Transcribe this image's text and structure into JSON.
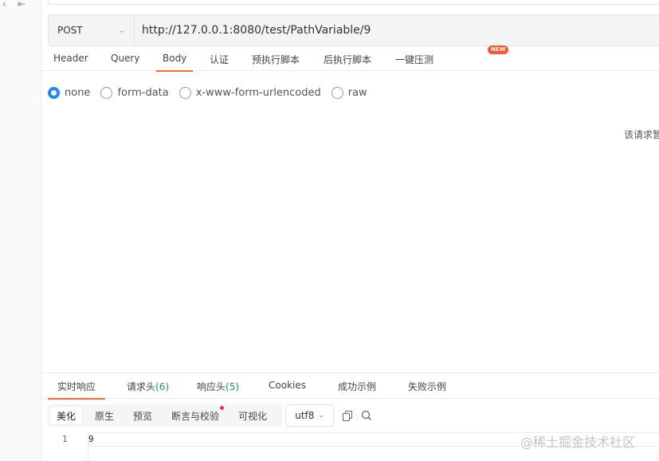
{
  "sidebar": {
    "glyphs": [
      "‹",
      "⇤"
    ]
  },
  "request": {
    "method": "POST",
    "url": "http://127.0.0.1:8080/test/PathVariable/9"
  },
  "request_tabs": [
    {
      "label": "Header",
      "active": false
    },
    {
      "label": "Query",
      "active": false
    },
    {
      "label": "Body",
      "active": true
    },
    {
      "label": "认证",
      "active": false
    },
    {
      "label": "预执行脚本",
      "active": false
    },
    {
      "label": "后执行脚本",
      "active": false
    },
    {
      "label": "一键压测",
      "active": false
    }
  ],
  "new_badge": "NEW",
  "body_types": [
    {
      "label": "none",
      "checked": true
    },
    {
      "label": "form-data",
      "checked": false
    },
    {
      "label": "x-www-form-urlencoded",
      "checked": false
    },
    {
      "label": "raw",
      "checked": false
    }
  ],
  "body_notice": "该请求暂",
  "response_tabs": [
    {
      "label": "实时响应",
      "count": "",
      "active": true
    },
    {
      "label": "请求头",
      "count": "(6)",
      "active": false
    },
    {
      "label": "响应头",
      "count": "(5)",
      "active": false
    },
    {
      "label": "Cookies",
      "count": "",
      "active": false
    },
    {
      "label": "成功示例",
      "count": "",
      "active": false
    },
    {
      "label": "失败示例",
      "count": "",
      "active": false
    }
  ],
  "response_view_modes": [
    {
      "label": "美化",
      "active": true,
      "dot": false
    },
    {
      "label": "原生",
      "active": false,
      "dot": false
    },
    {
      "label": "预览",
      "active": false,
      "dot": false
    },
    {
      "label": "断言与校验",
      "active": false,
      "dot": true
    },
    {
      "label": "可视化",
      "active": false,
      "dot": false
    }
  ],
  "encoding": "utf8",
  "icons": {
    "copy": "copy-icon",
    "search": "search-icon"
  },
  "editor": {
    "line_number": "1",
    "content": "9"
  },
  "watermark": "@稀土掘金技术社区",
  "colors": {
    "accent": "#ff6a2b",
    "radio_checked": "#1b8cf2",
    "count_green": "#18a058",
    "badge_red": "#f45a35"
  }
}
